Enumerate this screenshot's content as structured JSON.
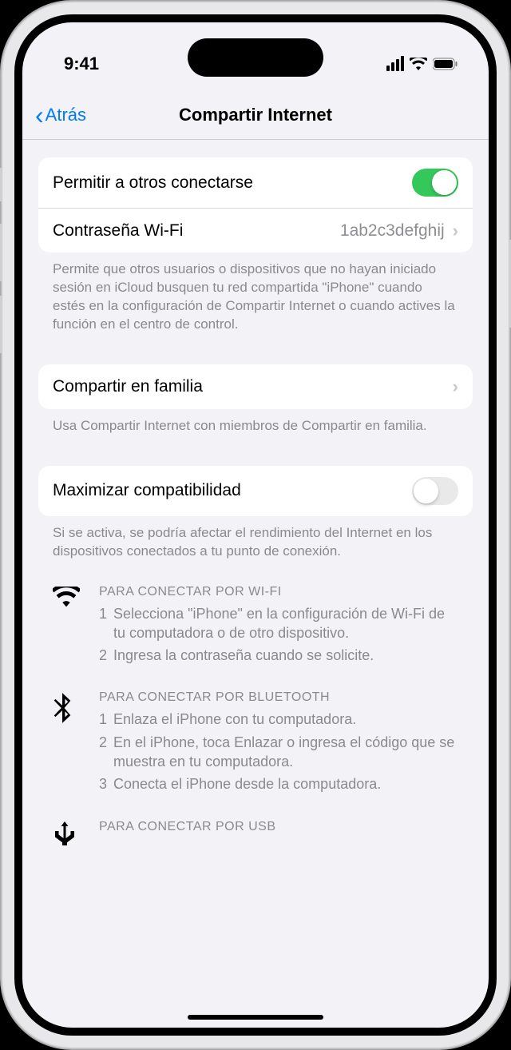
{
  "status": {
    "time": "9:41"
  },
  "nav": {
    "back": "Atrás",
    "title": "Compartir Internet"
  },
  "section1": {
    "allow_label": "Permitir a otros conectarse",
    "allow_on": true,
    "password_label": "Contraseña Wi-Fi",
    "password_value": "1ab2c3defghij",
    "footer": "Permite que otros usuarios o dispositivos que no hayan iniciado sesión en iCloud busquen tu red compartida \"iPhone\" cuando estés en la configuración de Compartir Internet o cuando actives la función en el centro de control."
  },
  "section2": {
    "family_label": "Compartir en familia",
    "footer": "Usa Compartir Internet con miembros de Compartir en familia."
  },
  "section3": {
    "compat_label": "Maximizar compatibilidad",
    "compat_on": false,
    "footer": "Si se activa, se podría afectar el rendimiento del Internet en los dispositivos conectados a tu punto de conexión."
  },
  "instructions": {
    "wifi": {
      "title": "PARA CONECTAR POR WI-FI",
      "steps": [
        "Selecciona \"iPhone\" en la configuración de Wi-Fi de tu computadora o de otro dispositivo.",
        "Ingresa la contraseña cuando se solicite."
      ]
    },
    "bluetooth": {
      "title": "PARA CONECTAR POR BLUETOOTH",
      "steps": [
        "Enlaza el iPhone con tu computadora.",
        "En el iPhone, toca Enlazar o ingresa el código que se muestra en tu computadora.",
        "Conecta el iPhone desde la computadora."
      ]
    },
    "usb": {
      "title": "PARA CONECTAR POR USB"
    }
  }
}
